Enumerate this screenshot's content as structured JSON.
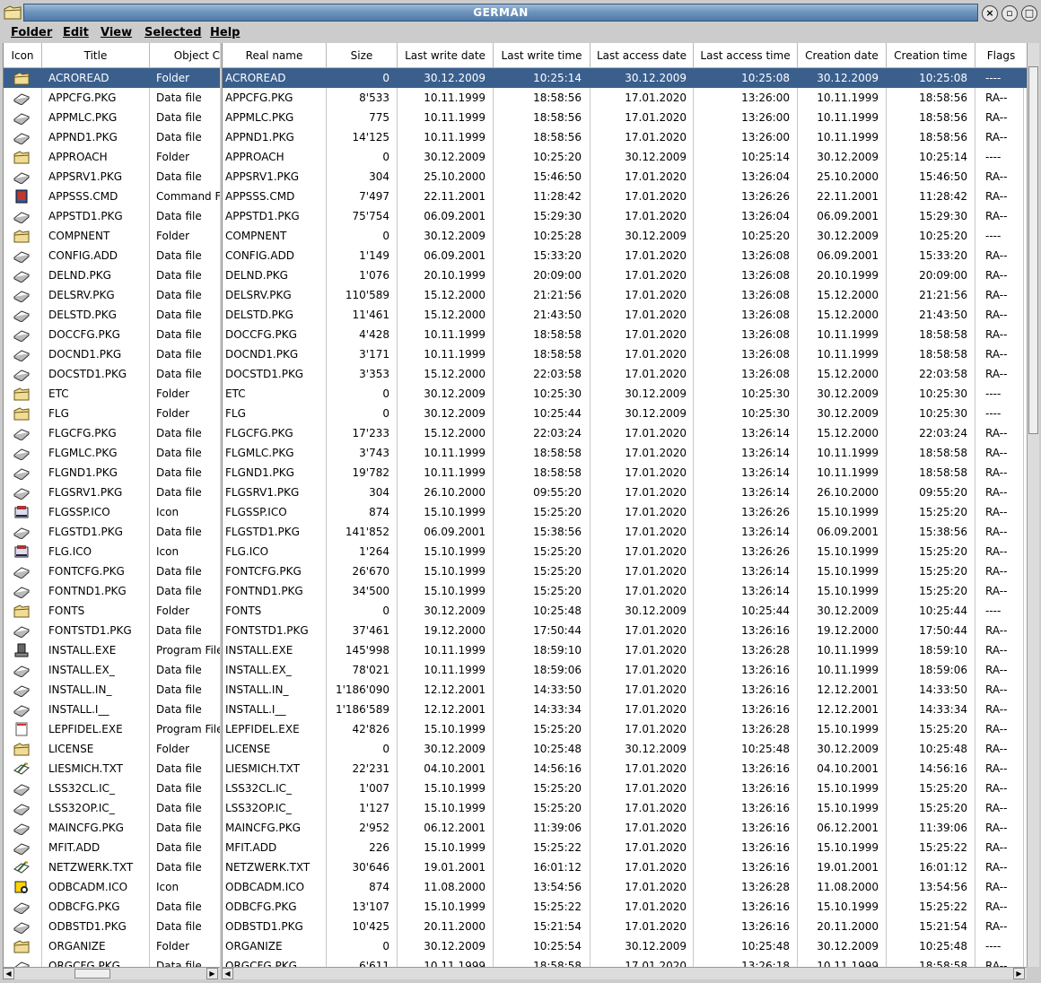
{
  "window": {
    "title": "GERMAN"
  },
  "menu": [
    "Folder",
    "Edit",
    "View",
    "Selected",
    "Help"
  ],
  "left_columns": [
    "Icon",
    "Title",
    "Object C"
  ],
  "right_columns": [
    "Real name",
    "Size",
    "Last write date",
    "Last write time",
    "Last access date",
    "Last access time",
    "Creation date",
    "Creation time",
    "Flags"
  ],
  "rows": [
    {
      "icon": "folder-icon",
      "title": "ACROREAD",
      "type": "Folder",
      "size": "0",
      "wd": "30.12.2009",
      "wt": "10:25:14",
      "ad": "30.12.2009",
      "at": "10:25:08",
      "cd": "30.12.2009",
      "ct": "10:25:08",
      "flags": "----",
      "selected": true
    },
    {
      "icon": "data-file-icon",
      "title": "APPCFG.PKG",
      "type": "Data file",
      "size": "8'533",
      "wd": "10.11.1999",
      "wt": "18:58:56",
      "ad": "17.01.2020",
      "at": "13:26:00",
      "cd": "10.11.1999",
      "ct": "18:58:56",
      "flags": "RA--"
    },
    {
      "icon": "data-file-icon",
      "title": "APPMLC.PKG",
      "type": "Data file",
      "size": "775",
      "wd": "10.11.1999",
      "wt": "18:58:56",
      "ad": "17.01.2020",
      "at": "13:26:00",
      "cd": "10.11.1999",
      "ct": "18:58:56",
      "flags": "RA--"
    },
    {
      "icon": "data-file-icon",
      "title": "APPND1.PKG",
      "type": "Data file",
      "size": "14'125",
      "wd": "10.11.1999",
      "wt": "18:58:56",
      "ad": "17.01.2020",
      "at": "13:26:00",
      "cd": "10.11.1999",
      "ct": "18:58:56",
      "flags": "RA--"
    },
    {
      "icon": "folder-icon",
      "title": "APPROACH",
      "type": "Folder",
      "size": "0",
      "wd": "30.12.2009",
      "wt": "10:25:20",
      "ad": "30.12.2009",
      "at": "10:25:14",
      "cd": "30.12.2009",
      "ct": "10:25:14",
      "flags": "----"
    },
    {
      "icon": "data-file-icon",
      "title": "APPSRV1.PKG",
      "type": "Data file",
      "size": "304",
      "wd": "25.10.2000",
      "wt": "15:46:50",
      "ad": "17.01.2020",
      "at": "13:26:04",
      "cd": "25.10.2000",
      "ct": "15:46:50",
      "flags": "RA--"
    },
    {
      "icon": "command-file-icon",
      "title": "APPSSS.CMD",
      "type": "Command F",
      "size": "7'497",
      "wd": "22.11.2001",
      "wt": "11:28:42",
      "ad": "17.01.2020",
      "at": "13:26:26",
      "cd": "22.11.2001",
      "ct": "11:28:42",
      "flags": "RA--"
    },
    {
      "icon": "data-file-icon",
      "title": "APPSTD1.PKG",
      "type": "Data file",
      "size": "75'754",
      "wd": "06.09.2001",
      "wt": "15:29:30",
      "ad": "17.01.2020",
      "at": "13:26:04",
      "cd": "06.09.2001",
      "ct": "15:29:30",
      "flags": "RA--"
    },
    {
      "icon": "folder-icon",
      "title": "COMPNENT",
      "type": "Folder",
      "size": "0",
      "wd": "30.12.2009",
      "wt": "10:25:28",
      "ad": "30.12.2009",
      "at": "10:25:20",
      "cd": "30.12.2009",
      "ct": "10:25:20",
      "flags": "----"
    },
    {
      "icon": "data-file-icon",
      "title": "CONFIG.ADD",
      "type": "Data file",
      "size": "1'149",
      "wd": "06.09.2001",
      "wt": "15:33:20",
      "ad": "17.01.2020",
      "at": "13:26:08",
      "cd": "06.09.2001",
      "ct": "15:33:20",
      "flags": "RA--"
    },
    {
      "icon": "data-file-icon",
      "title": "DELND.PKG",
      "type": "Data file",
      "size": "1'076",
      "wd": "20.10.1999",
      "wt": "20:09:00",
      "ad": "17.01.2020",
      "at": "13:26:08",
      "cd": "20.10.1999",
      "ct": "20:09:00",
      "flags": "RA--"
    },
    {
      "icon": "data-file-icon",
      "title": "DELSRV.PKG",
      "type": "Data file",
      "size": "110'589",
      "wd": "15.12.2000",
      "wt": "21:21:56",
      "ad": "17.01.2020",
      "at": "13:26:08",
      "cd": "15.12.2000",
      "ct": "21:21:56",
      "flags": "RA--"
    },
    {
      "icon": "data-file-icon",
      "title": "DELSTD.PKG",
      "type": "Data file",
      "size": "11'461",
      "wd": "15.12.2000",
      "wt": "21:43:50",
      "ad": "17.01.2020",
      "at": "13:26:08",
      "cd": "15.12.2000",
      "ct": "21:43:50",
      "flags": "RA--"
    },
    {
      "icon": "data-file-icon",
      "title": "DOCCFG.PKG",
      "type": "Data file",
      "size": "4'428",
      "wd": "10.11.1999",
      "wt": "18:58:58",
      "ad": "17.01.2020",
      "at": "13:26:08",
      "cd": "10.11.1999",
      "ct": "18:58:58",
      "flags": "RA--"
    },
    {
      "icon": "data-file-icon",
      "title": "DOCND1.PKG",
      "type": "Data file",
      "size": "3'171",
      "wd": "10.11.1999",
      "wt": "18:58:58",
      "ad": "17.01.2020",
      "at": "13:26:08",
      "cd": "10.11.1999",
      "ct": "18:58:58",
      "flags": "RA--"
    },
    {
      "icon": "data-file-icon",
      "title": "DOCSTD1.PKG",
      "type": "Data file",
      "size": "3'353",
      "wd": "15.12.2000",
      "wt": "22:03:58",
      "ad": "17.01.2020",
      "at": "13:26:08",
      "cd": "15.12.2000",
      "ct": "22:03:58",
      "flags": "RA--"
    },
    {
      "icon": "folder-icon",
      "title": "ETC",
      "type": "Folder",
      "size": "0",
      "wd": "30.12.2009",
      "wt": "10:25:30",
      "ad": "30.12.2009",
      "at": "10:25:30",
      "cd": "30.12.2009",
      "ct": "10:25:30",
      "flags": "----"
    },
    {
      "icon": "folder-icon",
      "title": "FLG",
      "type": "Folder",
      "size": "0",
      "wd": "30.12.2009",
      "wt": "10:25:44",
      "ad": "30.12.2009",
      "at": "10:25:30",
      "cd": "30.12.2009",
      "ct": "10:25:30",
      "flags": "----"
    },
    {
      "icon": "data-file-icon",
      "title": "FLGCFG.PKG",
      "type": "Data file",
      "size": "17'233",
      "wd": "15.12.2000",
      "wt": "22:03:24",
      "ad": "17.01.2020",
      "at": "13:26:14",
      "cd": "15.12.2000",
      "ct": "22:03:24",
      "flags": "RA--"
    },
    {
      "icon": "data-file-icon",
      "title": "FLGMLC.PKG",
      "type": "Data file",
      "size": "3'743",
      "wd": "10.11.1999",
      "wt": "18:58:58",
      "ad": "17.01.2020",
      "at": "13:26:14",
      "cd": "10.11.1999",
      "ct": "18:58:58",
      "flags": "RA--"
    },
    {
      "icon": "data-file-icon",
      "title": "FLGND1.PKG",
      "type": "Data file",
      "size": "19'782",
      "wd": "10.11.1999",
      "wt": "18:58:58",
      "ad": "17.01.2020",
      "at": "13:26:14",
      "cd": "10.11.1999",
      "ct": "18:58:58",
      "flags": "RA--"
    },
    {
      "icon": "data-file-icon",
      "title": "FLGSRV1.PKG",
      "type": "Data file",
      "size": "304",
      "wd": "26.10.2000",
      "wt": "09:55:20",
      "ad": "17.01.2020",
      "at": "13:26:14",
      "cd": "26.10.2000",
      "ct": "09:55:20",
      "flags": "RA--"
    },
    {
      "icon": "program-icon",
      "title": "FLGSSP.ICO",
      "type": "Icon",
      "size": "874",
      "wd": "15.10.1999",
      "wt": "15:25:20",
      "ad": "17.01.2020",
      "at": "13:26:26",
      "cd": "15.10.1999",
      "ct": "15:25:20",
      "flags": "RA--"
    },
    {
      "icon": "data-file-icon",
      "title": "FLGSTD1.PKG",
      "type": "Data file",
      "size": "141'852",
      "wd": "06.09.2001",
      "wt": "15:38:56",
      "ad": "17.01.2020",
      "at": "13:26:14",
      "cd": "06.09.2001",
      "ct": "15:38:56",
      "flags": "RA--"
    },
    {
      "icon": "program-icon",
      "title": "FLG.ICO",
      "type": "Icon",
      "size": "1'264",
      "wd": "15.10.1999",
      "wt": "15:25:20",
      "ad": "17.01.2020",
      "at": "13:26:26",
      "cd": "15.10.1999",
      "ct": "15:25:20",
      "flags": "RA--"
    },
    {
      "icon": "data-file-icon",
      "title": "FONTCFG.PKG",
      "type": "Data file",
      "size": "26'670",
      "wd": "15.10.1999",
      "wt": "15:25:20",
      "ad": "17.01.2020",
      "at": "13:26:14",
      "cd": "15.10.1999",
      "ct": "15:25:20",
      "flags": "RA--"
    },
    {
      "icon": "data-file-icon",
      "title": "FONTND1.PKG",
      "type": "Data file",
      "size": "34'500",
      "wd": "15.10.1999",
      "wt": "15:25:20",
      "ad": "17.01.2020",
      "at": "13:26:14",
      "cd": "15.10.1999",
      "ct": "15:25:20",
      "flags": "RA--"
    },
    {
      "icon": "folder-icon",
      "title": "FONTS",
      "type": "Folder",
      "size": "0",
      "wd": "30.12.2009",
      "wt": "10:25:48",
      "ad": "30.12.2009",
      "at": "10:25:44",
      "cd": "30.12.2009",
      "ct": "10:25:44",
      "flags": "----"
    },
    {
      "icon": "data-file-icon",
      "title": "FONTSTD1.PKG",
      "type": "Data file",
      "size": "37'461",
      "wd": "19.12.2000",
      "wt": "17:50:44",
      "ad": "17.01.2020",
      "at": "13:26:16",
      "cd": "19.12.2000",
      "ct": "17:50:44",
      "flags": "RA--"
    },
    {
      "icon": "installer-icon",
      "title": "INSTALL.EXE",
      "type": "Program File",
      "size": "145'998",
      "wd": "10.11.1999",
      "wt": "18:59:10",
      "ad": "17.01.2020",
      "at": "13:26:28",
      "cd": "10.11.1999",
      "ct": "18:59:10",
      "flags": "RA--"
    },
    {
      "icon": "data-file-icon",
      "title": "INSTALL.EX_",
      "type": "Data file",
      "size": "78'021",
      "wd": "10.11.1999",
      "wt": "18:59:06",
      "ad": "17.01.2020",
      "at": "13:26:16",
      "cd": "10.11.1999",
      "ct": "18:59:06",
      "flags": "RA--"
    },
    {
      "icon": "data-file-icon",
      "title": "INSTALL.IN_",
      "type": "Data file",
      "size": "1'186'090",
      "wd": "12.12.2001",
      "wt": "14:33:50",
      "ad": "17.01.2020",
      "at": "13:26:16",
      "cd": "12.12.2001",
      "ct": "14:33:50",
      "flags": "RA--"
    },
    {
      "icon": "data-file-icon",
      "title": "INSTALL.I__",
      "type": "Data file",
      "size": "1'186'589",
      "wd": "12.12.2001",
      "wt": "14:33:34",
      "ad": "17.01.2020",
      "at": "13:26:16",
      "cd": "12.12.2001",
      "ct": "14:33:34",
      "flags": "RA--"
    },
    {
      "icon": "exe-icon",
      "title": "LEPFIDEL.EXE",
      "type": "Program File",
      "size": "42'826",
      "wd": "15.10.1999",
      "wt": "15:25:20",
      "ad": "17.01.2020",
      "at": "13:26:28",
      "cd": "15.10.1999",
      "ct": "15:25:20",
      "flags": "RA--"
    },
    {
      "icon": "folder-icon",
      "title": "LICENSE",
      "type": "Folder",
      "size": "0",
      "wd": "30.12.2009",
      "wt": "10:25:48",
      "ad": "30.12.2009",
      "at": "10:25:48",
      "cd": "30.12.2009",
      "ct": "10:25:48",
      "flags": "RA--"
    },
    {
      "icon": "text-file-icon",
      "title": "LIESMICH.TXT",
      "type": "Data file",
      "size": "22'231",
      "wd": "04.10.2001",
      "wt": "14:56:16",
      "ad": "17.01.2020",
      "at": "13:26:16",
      "cd": "04.10.2001",
      "ct": "14:56:16",
      "flags": "RA--"
    },
    {
      "icon": "data-file-icon",
      "title": "LSS32CL.IC_",
      "type": "Data file",
      "size": "1'007",
      "wd": "15.10.1999",
      "wt": "15:25:20",
      "ad": "17.01.2020",
      "at": "13:26:16",
      "cd": "15.10.1999",
      "ct": "15:25:20",
      "flags": "RA--"
    },
    {
      "icon": "data-file-icon",
      "title": "LSS32OP.IC_",
      "type": "Data file",
      "size": "1'127",
      "wd": "15.10.1999",
      "wt": "15:25:20",
      "ad": "17.01.2020",
      "at": "13:26:16",
      "cd": "15.10.1999",
      "ct": "15:25:20",
      "flags": "RA--"
    },
    {
      "icon": "data-file-icon",
      "title": "MAINCFG.PKG",
      "type": "Data file",
      "size": "2'952",
      "wd": "06.12.2001",
      "wt": "11:39:06",
      "ad": "17.01.2020",
      "at": "13:26:16",
      "cd": "06.12.2001",
      "ct": "11:39:06",
      "flags": "RA--"
    },
    {
      "icon": "data-file-icon",
      "title": "MFIT.ADD",
      "type": "Data file",
      "size": "226",
      "wd": "15.10.1999",
      "wt": "15:25:22",
      "ad": "17.01.2020",
      "at": "13:26:16",
      "cd": "15.10.1999",
      "ct": "15:25:22",
      "flags": "RA--"
    },
    {
      "icon": "text-file-icon",
      "title": "NETZWERK.TXT",
      "type": "Data file",
      "size": "30'646",
      "wd": "19.01.2001",
      "wt": "16:01:12",
      "ad": "17.01.2020",
      "at": "13:26:16",
      "cd": "19.01.2001",
      "ct": "16:01:12",
      "flags": "RA--"
    },
    {
      "icon": "odbc-icon",
      "title": "ODBCADM.ICO",
      "type": "Icon",
      "size": "874",
      "wd": "11.08.2000",
      "wt": "13:54:56",
      "ad": "17.01.2020",
      "at": "13:26:28",
      "cd": "11.08.2000",
      "ct": "13:54:56",
      "flags": "RA--"
    },
    {
      "icon": "data-file-icon",
      "title": "ODBCFG.PKG",
      "type": "Data file",
      "size": "13'107",
      "wd": "15.10.1999",
      "wt": "15:25:22",
      "ad": "17.01.2020",
      "at": "13:26:16",
      "cd": "15.10.1999",
      "ct": "15:25:22",
      "flags": "RA--"
    },
    {
      "icon": "data-file-icon",
      "title": "ODBSTD1.PKG",
      "type": "Data file",
      "size": "10'425",
      "wd": "20.11.2000",
      "wt": "15:21:54",
      "ad": "17.01.2020",
      "at": "13:26:16",
      "cd": "20.11.2000",
      "ct": "15:21:54",
      "flags": "RA--"
    },
    {
      "icon": "folder-icon",
      "title": "ORGANIZE",
      "type": "Folder",
      "size": "0",
      "wd": "30.12.2009",
      "wt": "10:25:54",
      "ad": "30.12.2009",
      "at": "10:25:48",
      "cd": "30.12.2009",
      "ct": "10:25:48",
      "flags": "----"
    },
    {
      "icon": "data-file-icon",
      "title": "ORGCFG.PKG",
      "type": "Data file",
      "size": "6'611",
      "wd": "10.11.1999",
      "wt": "18:58:58",
      "ad": "17.01.2020",
      "at": "13:26:18",
      "cd": "10.11.1999",
      "ct": "18:58:58",
      "flags": "RA--"
    }
  ],
  "colors": {
    "selection": "#3a5f8d",
    "titlebar": "#6f95bd"
  }
}
